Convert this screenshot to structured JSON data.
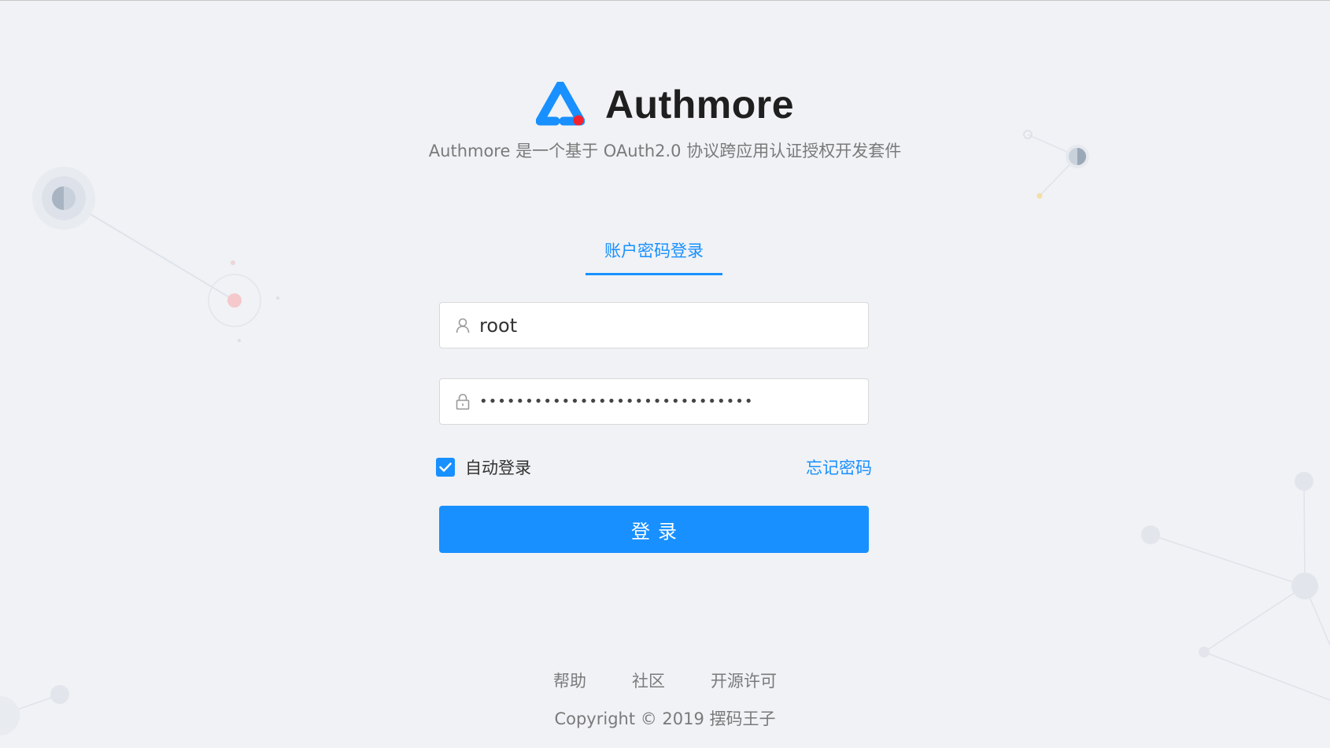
{
  "brand": {
    "title": "Authmore",
    "subtitle": "Authmore 是一个基于 OAuth2.0 协议跨应用认证授权开发套件",
    "colors": {
      "logo_blue": "#1890ff",
      "logo_dot": "#f5222d"
    }
  },
  "login": {
    "tab_label": "账户密码登录",
    "username": {
      "icon": "user-icon",
      "value": "root"
    },
    "password": {
      "icon": "lock-icon",
      "masked_value": "••••••••••••••••••••••••••••••"
    },
    "remember": {
      "checked": true,
      "label": "自动登录"
    },
    "forgot_label": "忘记密码",
    "submit_label": "登录"
  },
  "footer": {
    "links": [
      "帮助",
      "社区",
      "开源许可"
    ],
    "copyright": "Copyright © 2019 摆码王子"
  },
  "colors": {
    "primary": "#1890ff",
    "background": "#f0f2f5",
    "text_secondary": "#7a7a7a"
  }
}
